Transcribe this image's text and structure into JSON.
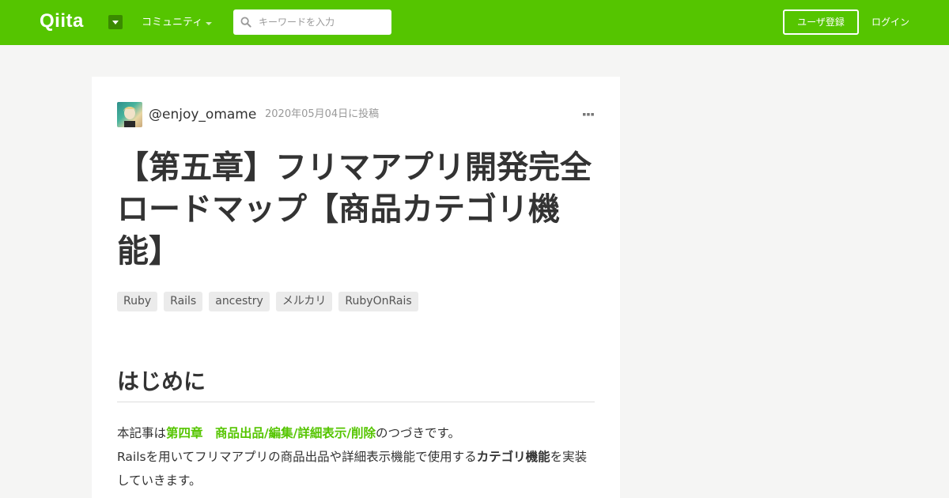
{
  "header": {
    "logo": "Qiita",
    "community_label": "コミュニティ",
    "search_placeholder": "キーワードを入力",
    "signup_label": "ユーザ登録",
    "login_label": "ログイン",
    "brand_color": "#55c500"
  },
  "article": {
    "author": "@enjoy_omame",
    "posted_date": "2020年05月04日に投稿",
    "title": "【第五章】フリマアプリ開発完全ロードマップ【商品カテゴリ機能】",
    "tags": [
      "Ruby",
      "Rails",
      "ancestry",
      "メルカリ",
      "RubyOnRais"
    ],
    "section_heading": "はじめに",
    "intro_prefix": "本記事は",
    "intro_link": "第四章　商品出品/編集/詳細表示/削除",
    "intro_suffix": "のつづきです。",
    "line2_prefix": "Railsを用いてフリマアプリの商品出品や詳細表示機能で使用する",
    "line2_bold": "カテゴリ機能",
    "line2_suffix": "を実装していきます。"
  },
  "icons": {
    "search": "search-icon",
    "more": "more-horizontal-icon",
    "caret": "caret-down-icon"
  }
}
